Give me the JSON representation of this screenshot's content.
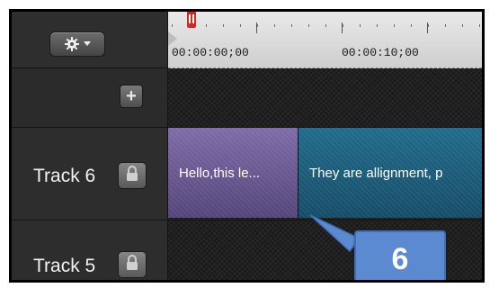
{
  "toolbar": {
    "gear_icon": "gear-icon",
    "dropdown_icon": "chevron-down-icon",
    "add_track_label": "+"
  },
  "ruler": {
    "timecodes": [
      "00:00:00;00",
      "00:00:10;00"
    ],
    "playhead_icon": "playhead-marker"
  },
  "tracks": [
    {
      "label": "Track 6",
      "lock_icon": "lock-icon",
      "clips": [
        {
          "text": "Hello,this le...",
          "color": "#6a5a93"
        },
        {
          "text": "They are allignment, p",
          "color": "#1a5a79"
        }
      ]
    },
    {
      "label": "Track 5",
      "lock_icon": "lock-icon",
      "clips": []
    }
  ],
  "callout": {
    "text": "6",
    "color": "#5b8ad0"
  }
}
